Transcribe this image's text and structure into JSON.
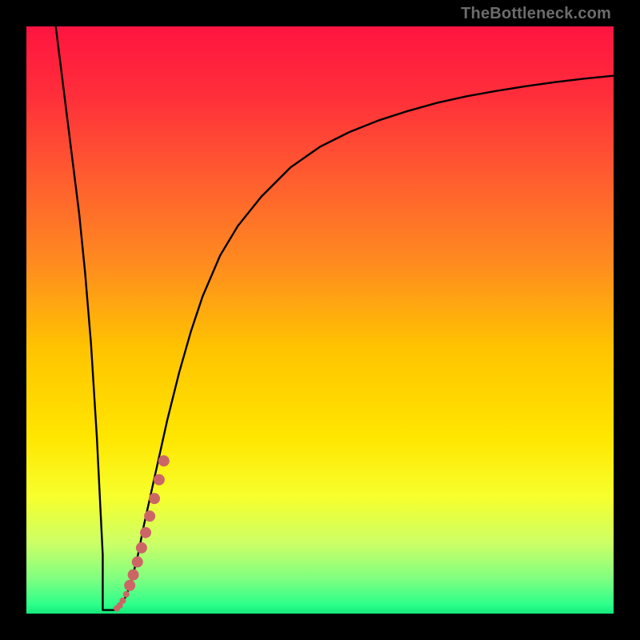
{
  "watermark": "TheBottleneck.com",
  "colors": {
    "frame": "#000000",
    "curve": "#000000",
    "dots": "#cc6666",
    "gradient_stops": [
      {
        "offset": 0.0,
        "color": "#ff1440"
      },
      {
        "offset": 0.12,
        "color": "#ff2f3a"
      },
      {
        "offset": 0.25,
        "color": "#ff5a30"
      },
      {
        "offset": 0.4,
        "color": "#ff8a20"
      },
      {
        "offset": 0.55,
        "color": "#ffc400"
      },
      {
        "offset": 0.7,
        "color": "#ffe600"
      },
      {
        "offset": 0.8,
        "color": "#f7ff2c"
      },
      {
        "offset": 0.88,
        "color": "#ccff66"
      },
      {
        "offset": 0.94,
        "color": "#80ff80"
      },
      {
        "offset": 0.985,
        "color": "#2cff8a"
      },
      {
        "offset": 1.0,
        "color": "#14e87a"
      }
    ]
  },
  "chart_data": {
    "type": "line",
    "title": "",
    "xlabel": "",
    "ylabel": "",
    "xlim": [
      0,
      100
    ],
    "ylim": [
      0,
      100
    ],
    "series": [
      {
        "name": "bottleneck-curve",
        "x": [
          5,
          6,
          7,
          8,
          9,
          10,
          11,
          12,
          13,
          13.5,
          14,
          14.5,
          15,
          16,
          17,
          18,
          19,
          20,
          22,
          24,
          26,
          28,
          30,
          33,
          36,
          40,
          45,
          50,
          55,
          60,
          65,
          70,
          75,
          80,
          85,
          90,
          95,
          100
        ],
        "y": [
          100,
          92,
          84,
          76,
          68,
          58,
          46,
          30,
          10,
          3,
          1,
          0.8,
          0.7,
          1.5,
          3,
          6,
          10,
          15,
          24,
          33,
          41,
          48,
          54,
          61,
          66,
          71,
          76,
          79.5,
          82,
          84,
          85.6,
          87,
          88.1,
          89,
          89.8,
          90.5,
          91.1,
          91.6
        ]
      }
    ],
    "notch": {
      "x_start": 13.0,
      "x_end": 15.0,
      "y": 0.6
    },
    "dots": {
      "name": "highlight-dots",
      "points": [
        {
          "x": 15.4,
          "y": 0.9,
          "r": 4
        },
        {
          "x": 15.9,
          "y": 1.4,
          "r": 4
        },
        {
          "x": 16.4,
          "y": 2.2,
          "r": 4
        },
        {
          "x": 17.0,
          "y": 3.3,
          "r": 4
        },
        {
          "x": 17.6,
          "y": 4.8,
          "r": 7
        },
        {
          "x": 18.2,
          "y": 6.6,
          "r": 7
        },
        {
          "x": 18.9,
          "y": 8.8,
          "r": 7
        },
        {
          "x": 19.6,
          "y": 11.2,
          "r": 7
        },
        {
          "x": 20.3,
          "y": 13.8,
          "r": 7
        },
        {
          "x": 21.0,
          "y": 16.6,
          "r": 7
        },
        {
          "x": 21.8,
          "y": 19.6,
          "r": 7
        },
        {
          "x": 22.6,
          "y": 22.8,
          "r": 7
        },
        {
          "x": 23.4,
          "y": 26.0,
          "r": 7
        }
      ]
    }
  }
}
